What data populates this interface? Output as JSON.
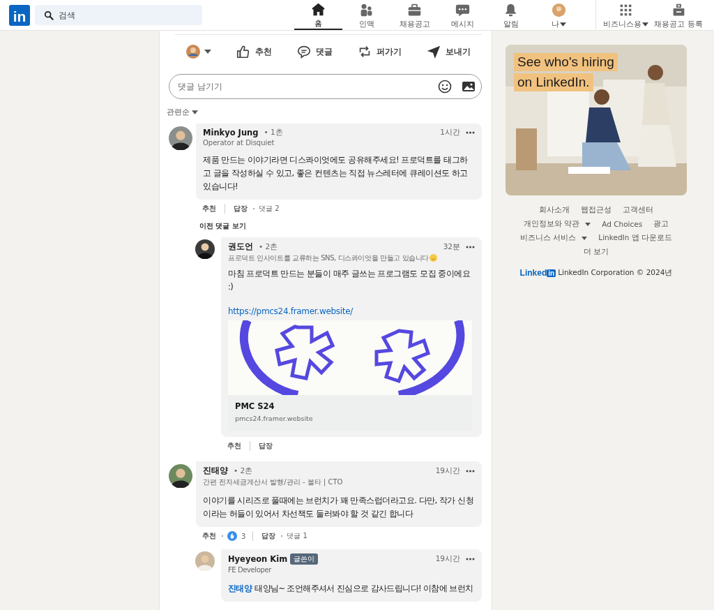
{
  "header": {
    "logo": "in",
    "search": {
      "placeholder": "검색"
    },
    "nav": [
      {
        "label": "홈",
        "kind": "home",
        "selected": true
      },
      {
        "label": "인맥",
        "kind": "network",
        "selected": false
      },
      {
        "label": "채용공고",
        "kind": "jobs",
        "selected": false
      },
      {
        "label": "메시지",
        "kind": "messages",
        "selected": false
      },
      {
        "label": "알림",
        "kind": "notifications",
        "selected": false
      },
      {
        "label": "나",
        "kind": "me",
        "selected": false,
        "dropdown": true
      }
    ],
    "business": {
      "label": "비즈니스용",
      "dropdown": true
    },
    "post_job": "채용공고 등록"
  },
  "post_actions": [
    {
      "kind": "reaction-picker"
    },
    {
      "kind": "like",
      "label": "추천"
    },
    {
      "kind": "comment",
      "label": "댓글"
    },
    {
      "kind": "repost",
      "label": "퍼가기"
    },
    {
      "kind": "send",
      "label": "보내기"
    }
  ],
  "comment_box": {
    "placeholder": "댓글 남기기"
  },
  "sort": "관련순",
  "comments": [
    {
      "name": "Minkyo Jung",
      "degree": "• 1촌",
      "time": "1시간",
      "headline": "Operator at Disquiet",
      "body": "제품 만드는 이야기라면 디스콰이엇에도 공유해주세요! 프로덕트를 태그하고 글을 작성하실 수 있고, 좋은 컨텐츠는 직접 뉴스레터에 큐레이션도 하고 있습니다!",
      "like": "추천",
      "reply": "답장",
      "reply_count": "댓글 2",
      "more_replies": "이전 댓글 보기",
      "children": [
        {
          "name": "권도언",
          "degree": "• 2촌",
          "time": "32분",
          "headline": "프로덕트 인사이트를 교류하는 SNS, 디스콰이엇을 만들고 있습니다",
          "headline_emoji": true,
          "body": "마침 프로덕트 만드는 분들이 매주 글쓰는 프로그램도 모집 중이에요 :)",
          "link": "https://pmcs24.framer.website/",
          "preview": {
            "kind": "picture",
            "title": "PMC S24",
            "domain": "pmcs24.framer.website"
          },
          "like": "추천",
          "reply": "답장"
        }
      ]
    },
    {
      "name": "진태양",
      "degree": "• 2촌",
      "time": "19시간",
      "headline": "간편 전자세금계산서 발행/관리 - 볼타 | CTO",
      "body": "이야기를 시리즈로 풀때에는 브런치가 꽤 만족스럽더라고요. 다만, 작가 신청이라는 허들이 있어서 차선책도 둘러봐야 할 것 같긴 합니다",
      "like": "추천",
      "reactions": "3",
      "reply": "답장",
      "reply_count": "댓글 1",
      "children": [
        {
          "name": "Hyeyeon Kim",
          "badge": "글쓴이",
          "time": "19시간",
          "headline": "FE Developer",
          "mention": "진태양",
          "body": "태양님~ 조언해주셔서 진심으로 감사드립니다! 이참에 브런치"
        }
      ]
    }
  ],
  "ad": {
    "kind": "picture",
    "headline": [
      "See who's hiring",
      "on LinkedIn."
    ]
  },
  "footer": {
    "rows": [
      {
        "links": [
          {
            "label": "회사소개"
          },
          {
            "label": "웹접근성"
          },
          {
            "label": "고객센터"
          }
        ]
      },
      {
        "links": [
          {
            "label": "개인정보와 약관",
            "dropdown": true
          },
          {
            "label": "Ad Choices"
          },
          {
            "label": "광고"
          }
        ]
      },
      {
        "links": [
          {
            "label": "비즈니스 서비스",
            "dropdown": true
          },
          {
            "label": "LinkedIn 앱 다운로드"
          }
        ]
      },
      {
        "links": [
          {
            "label": "더 보기"
          }
        ]
      }
    ],
    "brand": {
      "word": "Linked",
      "mark": "in",
      "text": "LinkedIn Corporation © 2024년"
    }
  }
}
